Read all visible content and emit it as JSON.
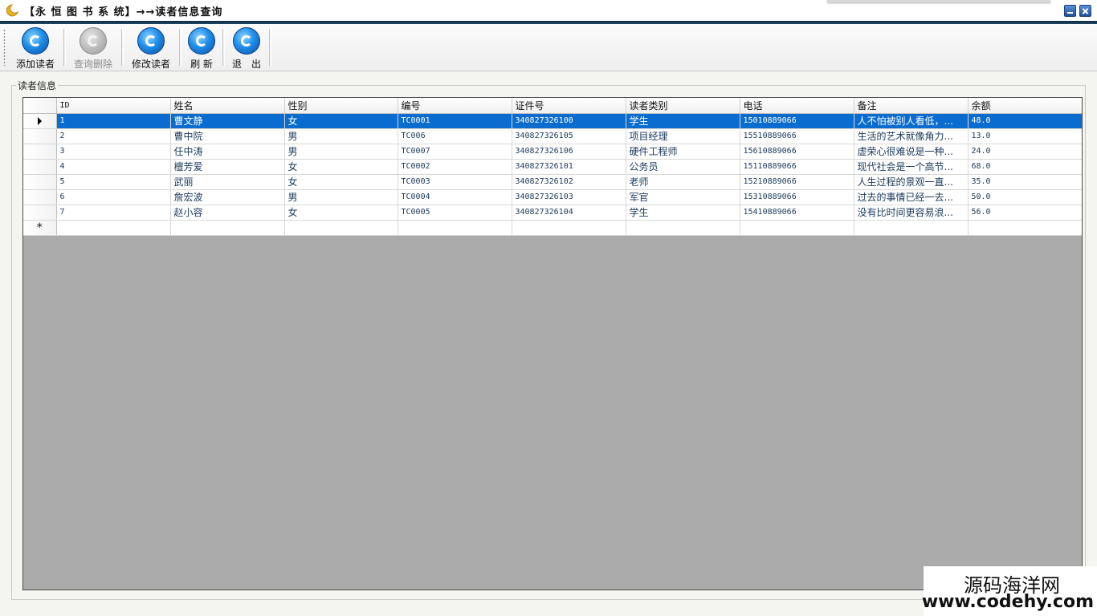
{
  "window": {
    "title": "【永 恒 图 书 系 统】→→读者信息查询"
  },
  "toolbar": {
    "buttons": [
      {
        "label": "添加读者",
        "icon": "add-reader-icon",
        "enabled": true
      },
      {
        "label": "查询删除",
        "icon": "query-delete-icon",
        "enabled": false
      },
      {
        "label": "修改读者",
        "icon": "edit-reader-icon",
        "enabled": true
      },
      {
        "label": "刷 新",
        "icon": "refresh-icon",
        "enabled": true
      },
      {
        "label": "退　出",
        "icon": "exit-icon",
        "enabled": true
      }
    ]
  },
  "groupbox": {
    "label": "读者信息"
  },
  "grid": {
    "columns": [
      "ID",
      "姓名",
      "性别",
      "编号",
      "证件号",
      "读者类别",
      "电话",
      "备注",
      "余额"
    ],
    "rows": [
      [
        "1",
        "曹文静",
        "女",
        "TC0001",
        "340827326100",
        "学生",
        "15010889066",
        "人不怕被别人看低，...",
        "48.0"
      ],
      [
        "2",
        "曹中院",
        "男",
        "TC006",
        "340827326105",
        "项目经理",
        "15510889066",
        "生活的艺术就像角力...",
        "13.0"
      ],
      [
        "3",
        "任中涛",
        "男",
        "TC0007",
        "340827326106",
        "硬件工程师",
        "15610889066",
        "虚荣心很难说是一种...",
        "24.0"
      ],
      [
        "4",
        "檀芳爱",
        "女",
        "TC0002",
        "340827326101",
        "公务员",
        "15110889066",
        "现代社会是一个高节...",
        "68.0"
      ],
      [
        "5",
        "武丽",
        "女",
        "TC0003",
        "340827326102",
        "老师",
        "15210889066",
        "人生过程的景观一直...",
        "35.0"
      ],
      [
        "6",
        "詹宏波",
        "男",
        "TC0004",
        "340827326103",
        "军官",
        "15310889066",
        "过去的事情已经一去...",
        "50.0"
      ],
      [
        "7",
        "赵小容",
        "女",
        "TC0005",
        "340827326104",
        "学生",
        "15410889066",
        "没有比时间更容易浪...",
        "56.0"
      ]
    ],
    "selected_row": 0,
    "new_row_marker": "*"
  },
  "watermark": {
    "text_cn": "源码海洋网",
    "url": "www.codehy.com"
  },
  "colors": {
    "selection": "#0a6ccf",
    "grid_background": "#ababab",
    "title_rule": "#0e2a3e"
  }
}
